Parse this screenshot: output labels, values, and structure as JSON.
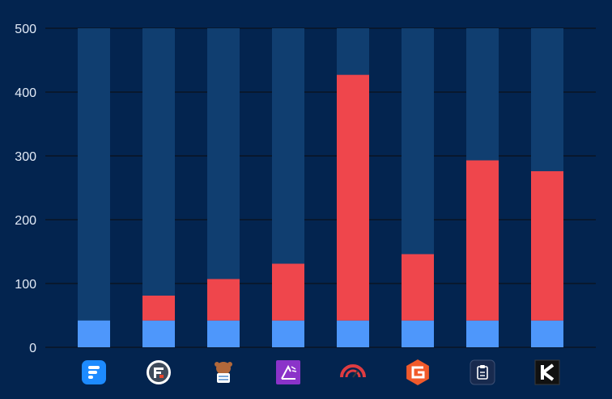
{
  "chart_data": {
    "type": "bar",
    "title": "",
    "xlabel": "",
    "ylabel": "",
    "ylim": [
      0,
      500
    ],
    "yticks": [
      0,
      100,
      200,
      300,
      400,
      500
    ],
    "grid": true,
    "stacked": true,
    "categories": [
      "fluent-forms-logo",
      "formidable-forms-logo",
      "wpforms-logo",
      "ninja-forms-logo",
      "everest-forms-logo",
      "gravity-forms-logo",
      "forminator-logo",
      "kali-forms-logo"
    ],
    "series": [
      {
        "values": [
          42,
          42,
          42,
          42,
          42,
          42,
          42,
          42
        ]
      },
      {
        "values": [
          0,
          39,
          65,
          89,
          385,
          104,
          251,
          234
        ]
      }
    ],
    "track_max": 500
  },
  "colors": {
    "background": "#03244f",
    "track": "#103e70",
    "gridline": "#0a1424",
    "axis_text": "#e3ebf7",
    "series_base": "#4e97fb",
    "series_top": "#ef464c"
  },
  "icons": [
    {
      "name": "fluent-forms-icon",
      "bg": "#1d8bff"
    },
    {
      "name": "formidable-forms-icon",
      "bg": "#3f4b5b"
    },
    {
      "name": "wpforms-icon",
      "bg": "#b2683a"
    },
    {
      "name": "ninja-forms-icon",
      "bg": "#8b33c9"
    },
    {
      "name": "everest-forms-icon",
      "bg": "#df3c41"
    },
    {
      "name": "gravity-forms-icon",
      "bg": "#f15a2b"
    },
    {
      "name": "forminator-icon",
      "bg": "#182a4e"
    },
    {
      "name": "kali-forms-icon",
      "bg": "#111111"
    }
  ]
}
